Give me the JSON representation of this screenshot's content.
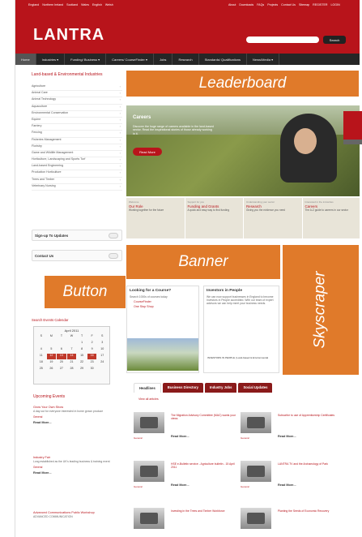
{
  "header": {
    "regions": [
      "England",
      "Northern Ireland",
      "Scotland",
      "Wales",
      "English",
      "Welsh"
    ],
    "top_links": [
      "About",
      "Downloads",
      "FAQs",
      "Projects",
      "Contact Us",
      "Sitemap",
      "REGISTER",
      "LOGIN"
    ],
    "logo": "LANTRA",
    "search_placeholder": "",
    "search_button": "Search"
  },
  "main_nav": [
    "Home",
    "Industries ▾",
    "Funding/ Business ▾",
    "Careers/ CourseFinder ▾",
    "Jobs",
    "Research",
    "Standards/ Qualifications",
    "News/Media ▾"
  ],
  "sidebar": {
    "title": "Land-based & Environmental Industries",
    "items": [
      "Agriculture",
      "Animal Care",
      "Animal Technology",
      "Aquaculture",
      "Environmental Conservation",
      "Equine",
      "Farriery",
      "Fencing",
      "Fisheries Management",
      "Floristry",
      "Game and Wildlife Management",
      "Horticulture, Landscaping and Sports Turf",
      "Land-based Engineering",
      "Production Horticulture",
      "Trees and Timber",
      "Veterinary Nursing"
    ],
    "signup": "Sign-up To Updates",
    "contact": "Contact Us",
    "calendar_title": "Search Events Calendar",
    "calendar_month": "April 2011",
    "calendar_days": [
      "S",
      "M",
      "T",
      "W",
      "T",
      "F",
      "S",
      "",
      "",
      "",
      "",
      "1",
      "2",
      "3",
      "4",
      "5",
      "6",
      "7",
      "8",
      "9",
      "10",
      "11",
      "12",
      "13",
      "14",
      "15",
      "16",
      "17",
      "18",
      "19",
      "20",
      "21",
      "22",
      "23",
      "24",
      "25",
      "26",
      "27",
      "28",
      "29",
      "30"
    ],
    "upcoming_title": "Upcoming Events",
    "events": [
      {
        "title": "Grow Your Own Show",
        "desc": "A day out for everyone interested in home grown produce",
        "cat": "General",
        "more": "Read More..."
      },
      {
        "title": "Industry Fair",
        "desc": "Long established as the UK's leading business & training event",
        "cat": "General",
        "more": "Read More..."
      },
      {
        "title": "Advanced Communications Public Workshop",
        "desc": "ADVANCED COMMUNICATION",
        "cat": "",
        "more": ""
      }
    ]
  },
  "hero": {
    "title": "Careers",
    "text": "Discover the huge range of careers available in the land-based sector. Read the inspirational stories of those already working in it.",
    "button": "Read More"
  },
  "features": [
    {
      "kicker": "Welcome",
      "heading": "Our Role",
      "text": "Working together for the future"
    },
    {
      "kicker": "Support for you",
      "heading": "Funding and Grants",
      "text": "A quick and easy way to find funding"
    },
    {
      "kicker": "Understanding your sector",
      "heading": "Research",
      "text": "Giving you the evidence you need"
    },
    {
      "kicker": "Interested in the industries",
      "heading": "Careers",
      "text": "The A-Z guide to careers in our sector"
    }
  ],
  "cards": {
    "course": {
      "title": "Looking for a Course?",
      "text": "Search 1000s of courses today",
      "links": [
        "CourseFinder",
        "One Stop Shop"
      ]
    },
    "iip": {
      "title": "Investors in People",
      "text": "We can now support businesses in England to become Investors in People accredited. With our team of expert advisors we can help meet your business needs.",
      "badge": "INVESTORS IN PEOPLE | Land-based & Environmental"
    }
  },
  "tabs": [
    "Headlines",
    "Business Directory",
    "Industry Jobs",
    "Social Updates"
  ],
  "view_all": "View all articles",
  "news": [
    {
      "title": "The Migration Advisory Committee (MAC) wants your views",
      "cat": "General",
      "more": "Read More..."
    },
    {
      "title": "Subscribe to use of Apprenticeship Certificates",
      "cat": "General",
      "more": "Read More..."
    },
    {
      "title": "HSE e-Bulletin service - Agriculture bulletin - 15 April 2011",
      "cat": "General",
      "more": "Read More..."
    },
    {
      "title": "LANTRA TV and the Archaeology of Park",
      "cat": "General",
      "more": "Read More..."
    },
    {
      "title": "Investing in the Trees and Timber Workforce",
      "cat": "",
      "more": ""
    },
    {
      "title": "Planting the Seeds of Economic Recovery",
      "cat": "",
      "more": ""
    }
  ],
  "ads": {
    "leaderboard": "Leaderboard",
    "banner": "Banner",
    "button": "Button",
    "skyscraper": "Skyscraper"
  },
  "colors": {
    "brand_red": "#b8141b",
    "ad_orange": "#e07a2a",
    "nav_dark": "#262626"
  }
}
